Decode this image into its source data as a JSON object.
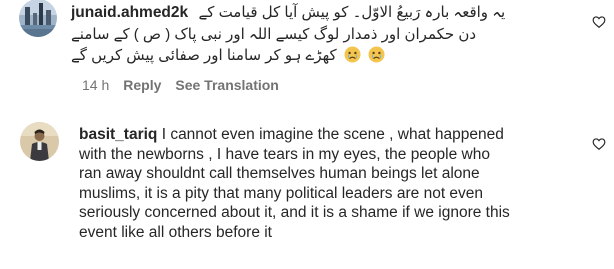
{
  "comments": [
    {
      "username": "junaid.ahmed2k",
      "lines": [
        "یہ واقعہ بارہ رَبیعُ الاوّل۔ کو پیش آیا کل قیامت کے",
        "دن حکمران اور ذمدار لوگ کیسے اللہ اور نبی پاک ( ص ) کے سامنے",
        "کھڑے ہو کر سامنا اور صفائی پیش کریں گے"
      ],
      "emoji": [
        "crying-face",
        "crying-face"
      ],
      "time": "14 h",
      "reply_label": "Reply",
      "translate_label": "See Translation"
    },
    {
      "username": "basit_tariq",
      "lines": [
        "I cannot even imagine the scene , what happened",
        "with the newborns , I have tears in my eyes, the people who",
        "ran away shouldnt call themselves human beings let alone",
        "muslims, it is a pity that many political leaders are not even",
        "seriously concerned about it, and it is a shame if we ignore this",
        "event like all others before it"
      ]
    }
  ],
  "icons": {
    "like": "heart-outline-icon"
  },
  "colors": {
    "text": "#262626",
    "secondary": "#737373",
    "background": "#ffffff"
  }
}
